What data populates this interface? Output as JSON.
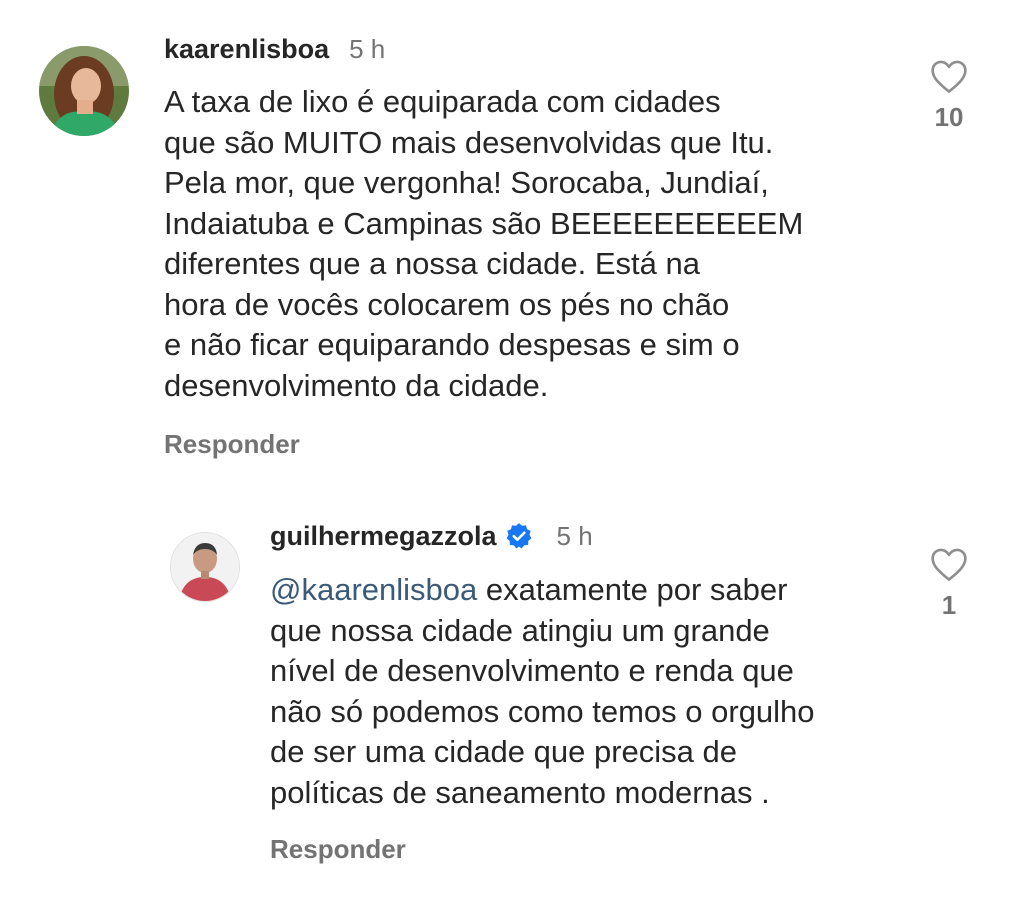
{
  "comments": [
    {
      "username": "kaarenlisboa",
      "time": "5 h",
      "verified": false,
      "text_lines": [
        "A taxa de lixo é equiparada com cidades",
        "que são MUITO mais desenvolvidas que Itu.",
        "Pela mor, que vergonha! Sorocaba, Jundiaí,",
        "Indaiatuba e Campinas são BEEEEEEEEEEM",
        "diferentes que a nossa cidade. Está na",
        "hora de vocês colocarem os pés no chão",
        "e não ficar equiparando despesas e sim o",
        "desenvolvimento da cidade."
      ],
      "reply_label": "Responder",
      "likes": "10",
      "avatar_icon": "profile-photo-woman"
    },
    {
      "username": "guilhermegazzola",
      "time": "5 h",
      "verified": true,
      "verified_icon": "verified-badge-icon",
      "mention": "@kaarenlisboa",
      "text_first_rest": " exatamente por saber",
      "text_lines": [
        "que nossa cidade atingiu um grande",
        "nível de desenvolvimento e renda que",
        "não só podemos como temos o orgulho",
        "de ser uma cidade que precisa de",
        "políticas de saneamento modernas ."
      ],
      "reply_label": "Responder",
      "likes": "1",
      "avatar_icon": "profile-photo-man"
    }
  ],
  "colors": {
    "text": "#262626",
    "secondary": "#737373",
    "mention": "#3a5a78",
    "verified": "#1877f2"
  },
  "icons": {
    "like": "heart-outline-icon"
  }
}
